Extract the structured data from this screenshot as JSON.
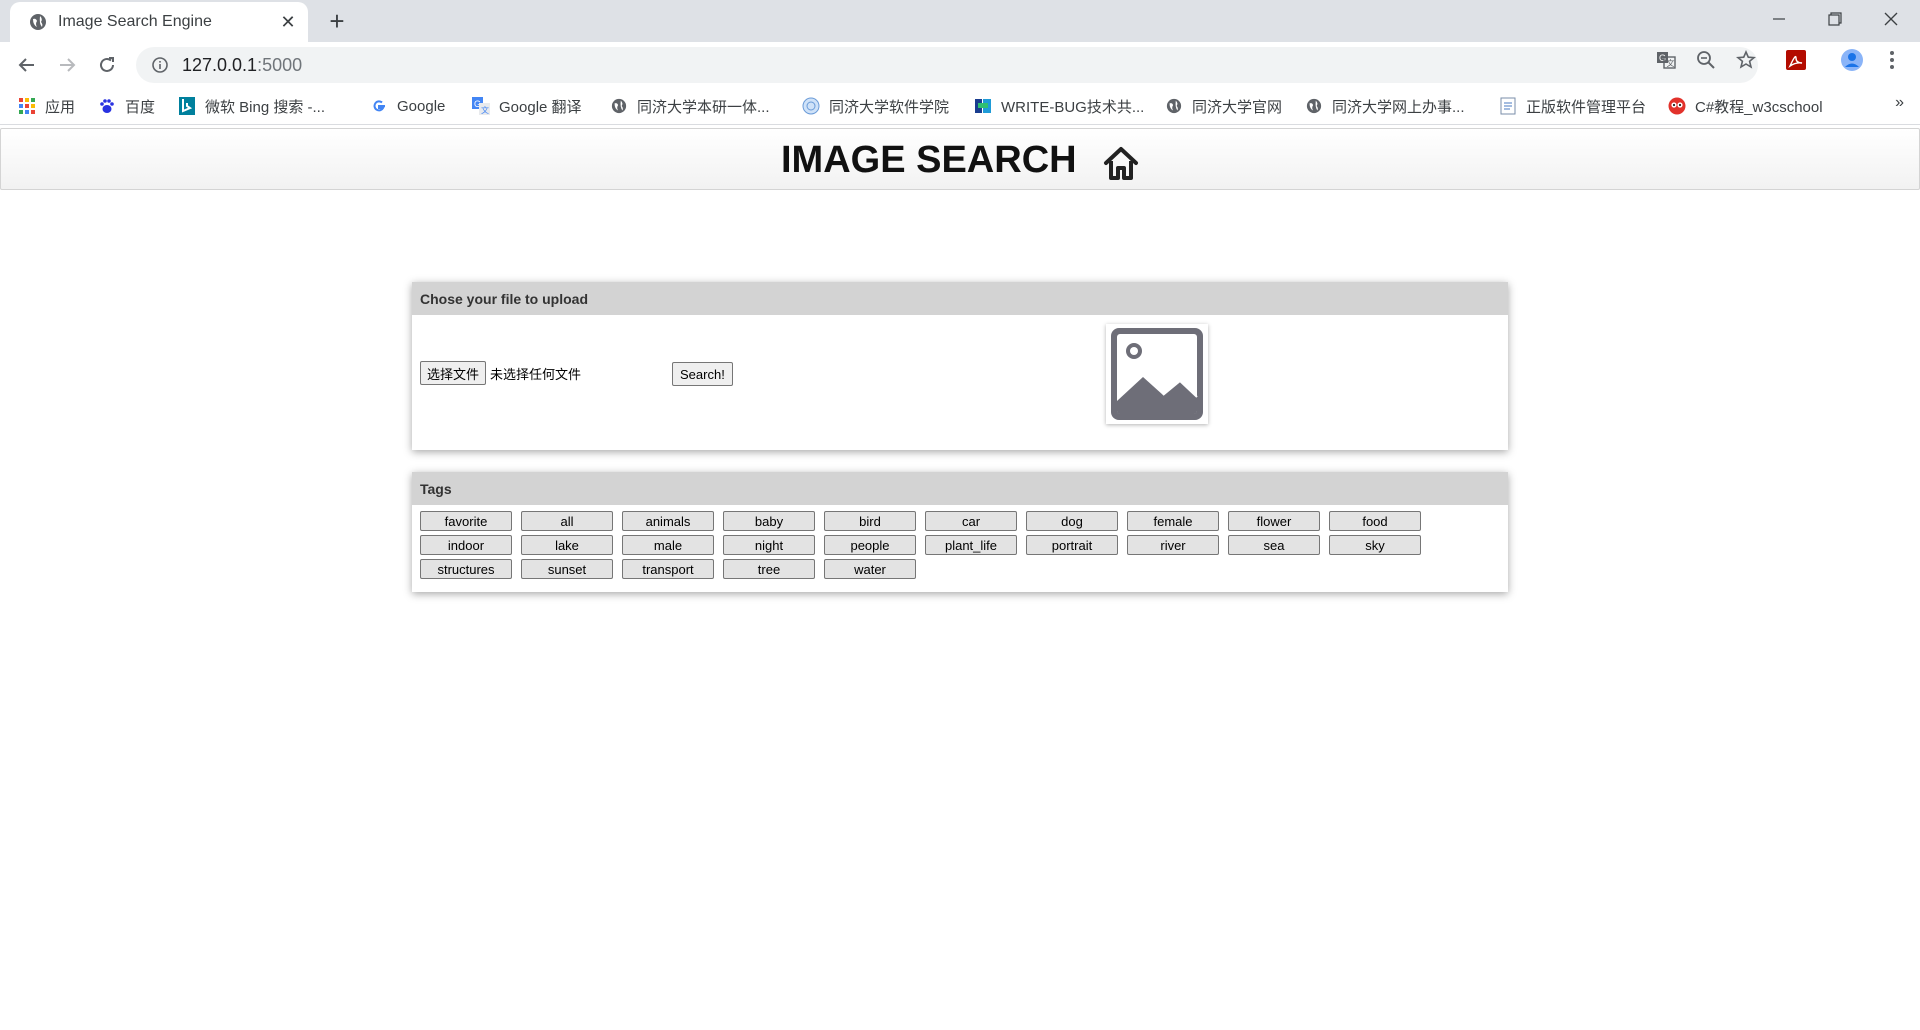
{
  "browser": {
    "tab_title": "Image Search Engine",
    "new_tab_symbol": "+",
    "url_host": "127.0.0.1",
    "url_port": ":5000",
    "bookmarks": [
      {
        "label": "应用",
        "icon": "apps-grid-icon"
      },
      {
        "label": "百度",
        "icon": "baidu-paw-icon"
      },
      {
        "label": "微软 Bing 搜索 -...",
        "icon": "bing-icon"
      },
      {
        "label": "Google",
        "icon": "google-icon"
      },
      {
        "label": "Google 翻译",
        "icon": "google-translate-icon"
      },
      {
        "label": "同济大学本研一体...",
        "icon": "globe-icon"
      },
      {
        "label": "同济大学软件学院",
        "icon": "tongji-sse-icon"
      },
      {
        "label": "WRITE-BUG技术共...",
        "icon": "writebug-icon"
      },
      {
        "label": "同济大学官网",
        "icon": "globe-icon"
      },
      {
        "label": "同济大学网上办事...",
        "icon": "globe-icon"
      },
      {
        "label": "正版软件管理平台",
        "icon": "document-icon"
      },
      {
        "label": "C#教程_w3cschool",
        "icon": "w3cschool-owl-icon"
      }
    ],
    "more_bookmarks": "»"
  },
  "app": {
    "brand": "IMAGE SEARCH",
    "upload": {
      "heading": "Chose your file to upload",
      "choose_file_label": "选择文件",
      "no_file_text": "未选择任何文件",
      "search_label": "Search!"
    },
    "tags": {
      "heading": "Tags",
      "items": [
        "favorite",
        "all",
        "animals",
        "baby",
        "bird",
        "car",
        "dog",
        "female",
        "flower",
        "food",
        "indoor",
        "lake",
        "male",
        "night",
        "people",
        "plant_life",
        "portrait",
        "river",
        "sea",
        "sky",
        "structures",
        "sunset",
        "transport",
        "tree",
        "water"
      ]
    }
  },
  "colors": {
    "panel_heading_bg": "#d3d3d3",
    "tab_strip_bg": "#dee1e6",
    "preview_icon": "#6e6e78"
  }
}
